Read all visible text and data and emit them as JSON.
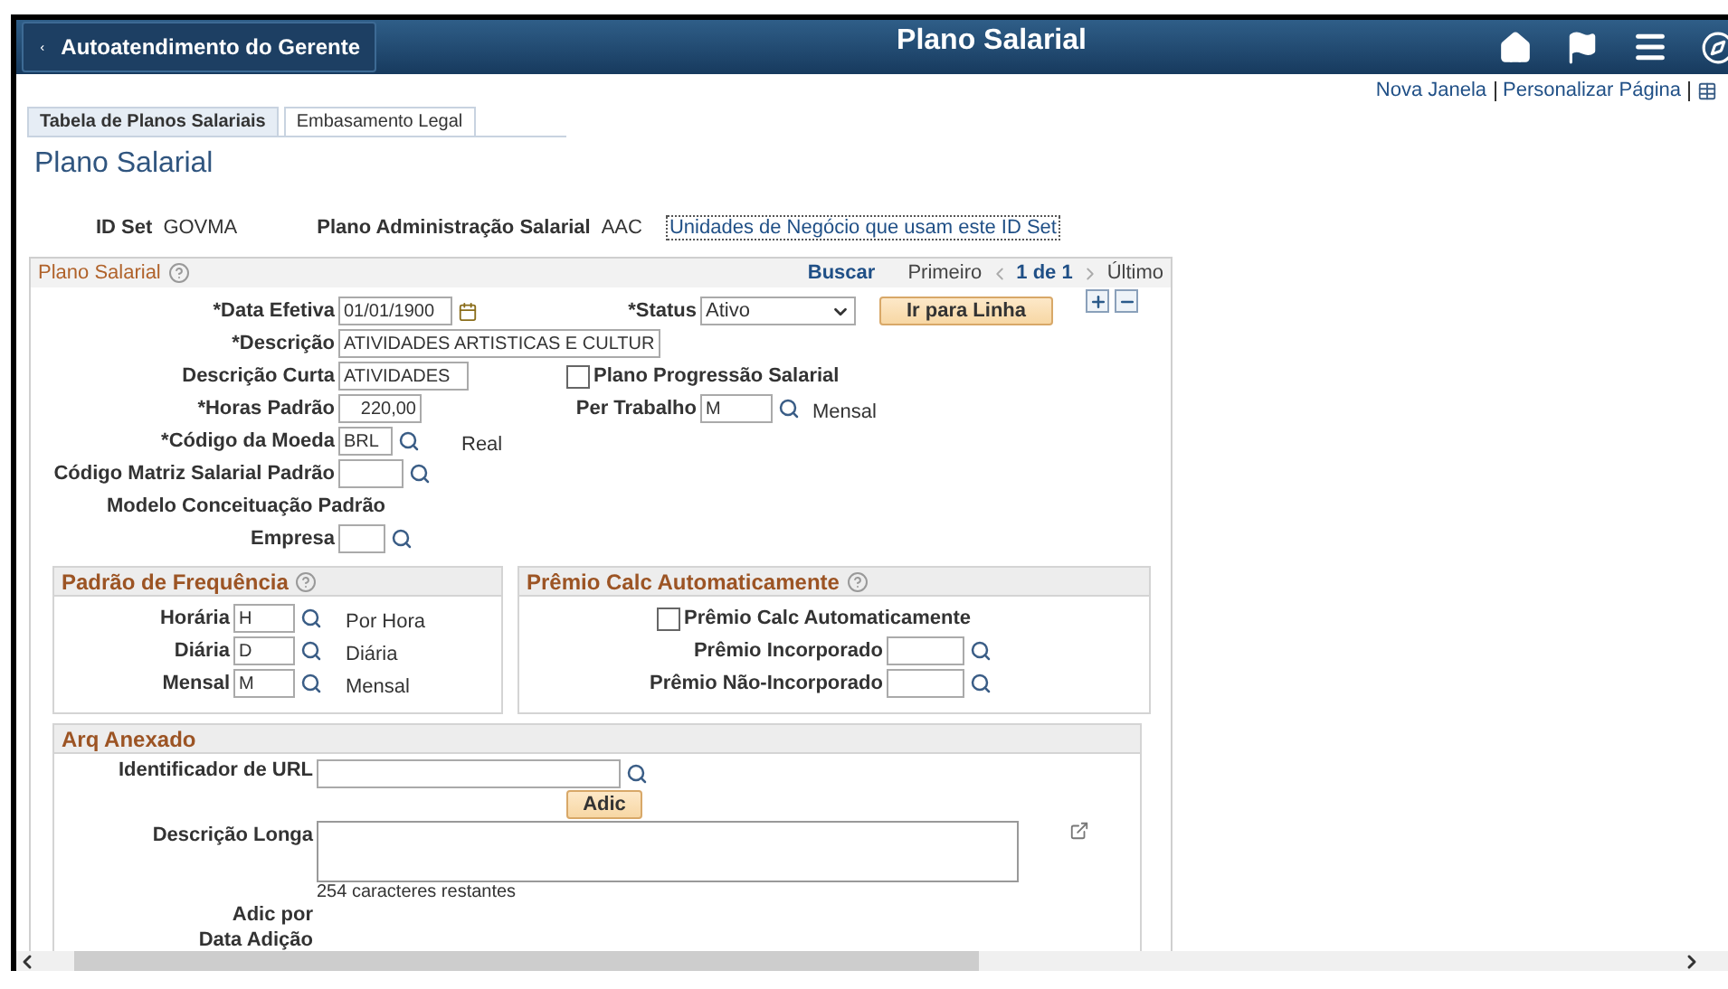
{
  "header": {
    "back_button": "Autoatendimento do Gerente",
    "title": "Plano Salarial"
  },
  "top_links": [
    "Nova Janela",
    "Personalizar Página"
  ],
  "tabs": [
    {
      "label": "Tabela de Planos Salariais",
      "selected": true
    },
    {
      "label": "Embasamento Legal",
      "selected": false
    }
  ],
  "page_title": "Plano Salarial",
  "key_info": {
    "id_set_label": "ID Set",
    "id_set_value": "GOVMA",
    "plan_label": "Plano Administração Salarial",
    "plan_value": "AAC",
    "link": "Unidades de Negócio que usam este ID Set"
  },
  "plan_panel": {
    "title": "Plano Salarial",
    "find": "Buscar",
    "first": "Primeiro",
    "count": "1 de 1",
    "last": "Último",
    "go_button": "Ir para Linha",
    "effective_date": {
      "label": "*Data Efetiva",
      "value": "01/01/1900"
    },
    "status": {
      "label": "*Status",
      "value": "Ativo"
    },
    "description": {
      "label": "*Descrição",
      "value": "ATIVIDADES ARTISTICAS E CULTUR"
    },
    "short_description": {
      "label": "Descrição Curta",
      "value": "ATIVIDADES"
    },
    "progression": {
      "label": "Plano Progressão Salarial",
      "checked": false
    },
    "standard_hours": {
      "label": "*Horas Padrão",
      "value": "220,00"
    },
    "work_period": {
      "label": "Per Trabalho",
      "value": "M",
      "description": "Mensal"
    },
    "currency": {
      "label": "*Código da Moeda",
      "value": "BRL",
      "description": "Real"
    },
    "matrix": {
      "label": "Código Matriz Salarial Padrão"
    },
    "model_heading": "Modelo Conceituação Padrão",
    "company": {
      "label": "Empresa"
    }
  },
  "frequency_panel": {
    "title": "Padrão de Frequência",
    "rows": [
      {
        "label": "Horária",
        "value": "H",
        "description": "Por Hora"
      },
      {
        "label": "Diária",
        "value": "D",
        "description": "Diária"
      },
      {
        "label": "Mensal",
        "value": "M",
        "description": "Mensal"
      }
    ]
  },
  "premium_panel": {
    "title": "Prêmio Calc Automaticamente",
    "checkbox": {
      "label": "Prêmio Calc Automaticamente",
      "checked": false
    },
    "fields": [
      {
        "label": "Prêmio Incorporado"
      },
      {
        "label": "Prêmio Não-Incorporado"
      }
    ]
  },
  "attachment_panel": {
    "title": "Arq Anexado",
    "url_label": "Identificador de URL",
    "add_button": "Adic",
    "long_description_label": "Descrição Longa",
    "remaining": "254 caracteres restantes",
    "added_by_label": "Adic por",
    "added_date_label": "Data Adição"
  }
}
